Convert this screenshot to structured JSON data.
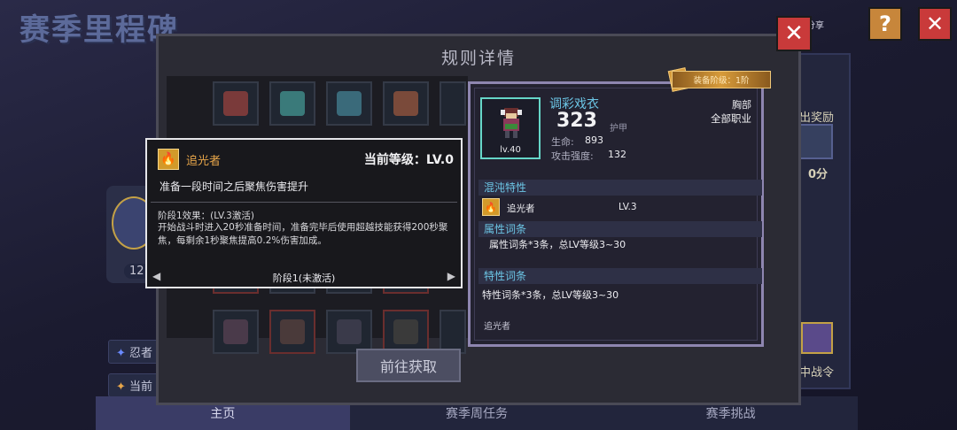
{
  "background": {
    "title": "赛季里程碑",
    "badge_count": "12",
    "tags": [
      "忍者",
      "当前"
    ],
    "share_label": "分享",
    "reward_label": "出奖励",
    "score_label": "0分",
    "season_pass_label": "中战令",
    "tabs": [
      "主页",
      "赛季周任务",
      "赛季挑战"
    ],
    "help_symbol": "?",
    "close_symbol": "✕"
  },
  "dialog": {
    "title": "规则详情",
    "close_symbol": "✕",
    "goto_button": "前往获取"
  },
  "skill_tooltip": {
    "icon": "flame-icon",
    "name": "追光者",
    "current_level": "当前等级：LV.0",
    "description": "准备一段时间之后聚焦伤害提升",
    "stage_title": "阶段1效果：(LV.3激活)",
    "stage_effect": "开始战斗时进入20秒准备时间，准备完毕后使用超越技能获得200秒聚焦，每剩余1秒聚焦提高0.2%伤害加成。",
    "page_label": "阶段1(未激活)",
    "prev_arrow": "◀",
    "next_arrow": "▶"
  },
  "equipment_card": {
    "stage_banner": "装备阶级：1阶",
    "portrait_level": "lv.40",
    "name": "调彩戏衣",
    "armor_value": "323",
    "armor_label": "护甲",
    "slot": "胸部",
    "classes": "全部职业",
    "stats": [
      {
        "label": "生命:",
        "value": "893"
      },
      {
        "label": "攻击强度:",
        "value": "132"
      }
    ],
    "chaos_section": "混沌特性",
    "chaos_name": "追光者",
    "chaos_level": "LV.3",
    "attr_section": "属性词条",
    "attr_text": "属性词条*3条，总LV等级3~30",
    "trait_section": "特性词条",
    "trait_text": "特性词条*3条，总LV等级3~30",
    "footer_name": "追光者"
  },
  "colors": {
    "accent_cyan": "#6cc6e6",
    "skill_orange": "#e8a64a",
    "close_red": "#c93a3a",
    "banner_gold": "#d79b3a"
  }
}
